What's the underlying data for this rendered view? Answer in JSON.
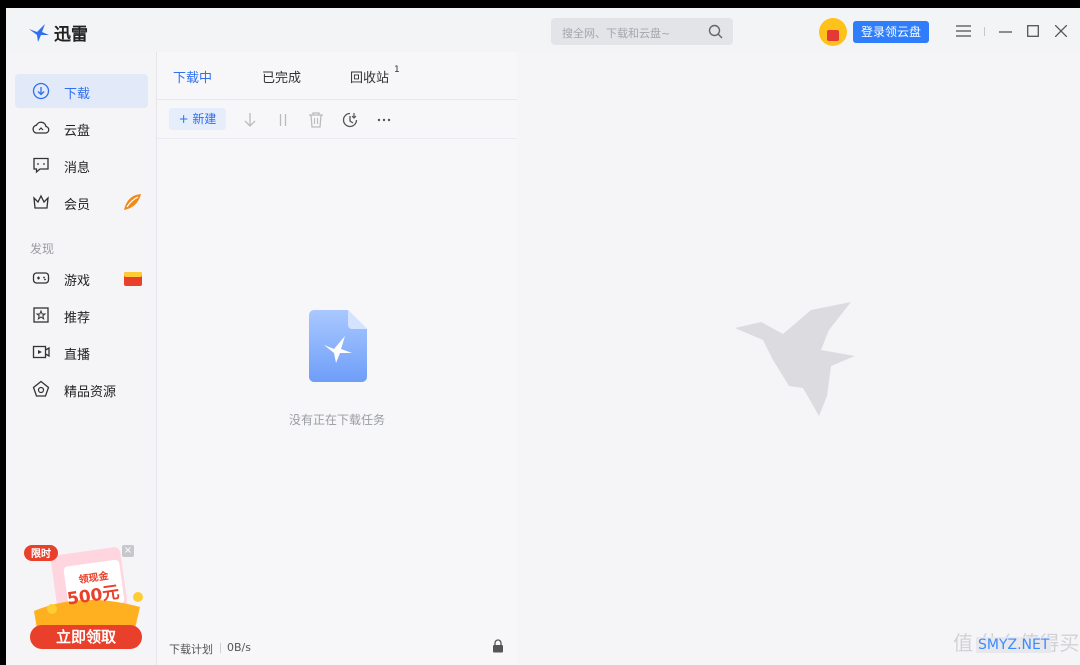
{
  "app": {
    "name": "迅雷"
  },
  "search": {
    "placeholder": "搜全网、下载和云盘~"
  },
  "header": {
    "login_button": "登录领云盘"
  },
  "sidebar": {
    "items": [
      {
        "label": "下载",
        "icon": "download-icon",
        "active": true
      },
      {
        "label": "云盘",
        "icon": "cloud-icon"
      },
      {
        "label": "消息",
        "icon": "message-icon"
      },
      {
        "label": "会员",
        "icon": "crown-icon"
      }
    ],
    "section_label": "发现",
    "discover_items": [
      {
        "label": "游戏",
        "icon": "gamepad-icon"
      },
      {
        "label": "推荐",
        "icon": "star-icon"
      },
      {
        "label": "直播",
        "icon": "live-video-icon"
      },
      {
        "label": "精品资源",
        "icon": "gem-icon"
      }
    ],
    "promo": {
      "tag": "限时",
      "amount_label": "领现金",
      "amount": "500元",
      "cta": "立即领取"
    }
  },
  "tabs": [
    {
      "label": "下载中",
      "active": true
    },
    {
      "label": "已完成"
    },
    {
      "label": "回收站",
      "badge": "1"
    }
  ],
  "toolbar": {
    "new_label": "+ 新建"
  },
  "empty_state": {
    "message": "没有正在下载任务"
  },
  "footer": {
    "plan_label": "下载计划",
    "speed": "0B/s"
  },
  "watermark": {
    "text": "值 什么值得买",
    "site": "SMYZ.NET"
  },
  "colors": {
    "accent": "#2f6ff0",
    "login_button": "#2f7dfa",
    "promo_red": "#e8402a"
  }
}
